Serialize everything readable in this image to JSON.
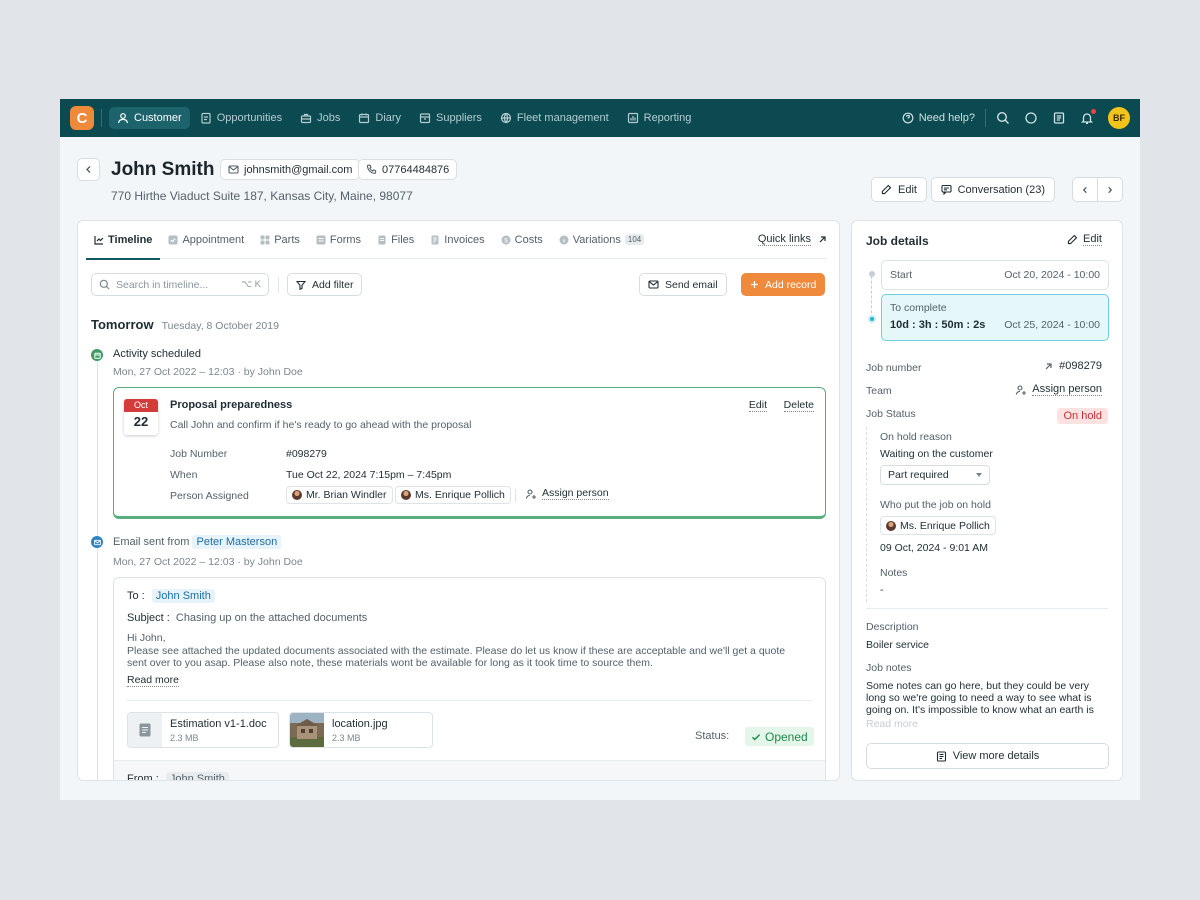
{
  "topbar": {
    "logo": "C",
    "nav": [
      {
        "label": "Customer",
        "icon": "user-icon",
        "active": true
      },
      {
        "label": "Opportunities",
        "icon": "clipboard-icon"
      },
      {
        "label": "Jobs",
        "icon": "briefcase-icon"
      },
      {
        "label": "Diary",
        "icon": "calendar-icon"
      },
      {
        "label": "Suppliers",
        "icon": "box-icon"
      },
      {
        "label": "Fleet management",
        "icon": "globe-icon"
      },
      {
        "label": "Reporting",
        "icon": "chart-icon"
      }
    ],
    "help": "Need help?",
    "avatar": "BF"
  },
  "header": {
    "name": "John Smith",
    "email": "johnsmith@gmail.com",
    "phone": "07764484876",
    "address": "770 Hirthe Viaduct Suite 187, Kansas City, Maine, 98077",
    "edit_label": "Edit",
    "conversation_label": "Conversation (23)"
  },
  "tabs": {
    "items": [
      {
        "label": "Timeline",
        "active": true
      },
      {
        "label": "Appointment"
      },
      {
        "label": "Parts"
      },
      {
        "label": "Forms"
      },
      {
        "label": "Files"
      },
      {
        "label": "Invoices"
      },
      {
        "label": "Costs"
      },
      {
        "label": "Variations",
        "badge": "104"
      }
    ],
    "quick_links": "Quick links"
  },
  "toolbar": {
    "search_placeholder": "Search in timeline...",
    "search_shortcut": "⌥ K",
    "add_filter": "Add filter",
    "send_email": "Send email",
    "add_record": "Add record"
  },
  "timeline": {
    "day": "Tomorrow",
    "date": "Tuesday, 8 October 2019",
    "event1": {
      "title": "Activity scheduled",
      "meta": "Mon, 27 Oct 2022 – 12:03",
      "by": "by John Doe",
      "card": {
        "cal_month": "Oct",
        "cal_day": "22",
        "title": "Proposal preparedness",
        "subtitle": "Call John and confirm if he's ready to go ahead with the proposal",
        "edit": "Edit",
        "delete": "Delete",
        "job_number_label": "Job Number",
        "job_number": "#098279",
        "when_label": "When",
        "when": "Tue Oct 22, 2024 7:15pm – 7:45pm",
        "person_label": "Person Assigned",
        "person1": "Mr. Brian Windler",
        "person2": "Ms. Enrique Pollich",
        "assign": "Assign person"
      }
    },
    "event2": {
      "title_prefix": "Email sent from",
      "sender": "Peter Masterson",
      "meta": "Mon, 27 Oct 2022 – 12:03",
      "by": "by John Doe",
      "to_label": "To :",
      "to": "John Smith",
      "subject_label": "Subject :",
      "subject": "Chasing up on the attached documents",
      "body": "Hi John,\nPlease see attached the updated documents associated with the estimate.  Please do let us know  if these are acceptable and we'll get a quote sent over to you asap. Please also note, these materials wont be available for long as it took time to source them.",
      "read_more": "Read more",
      "attachments": [
        {
          "name": "Estimation v1-1.doc",
          "size": "2.3 MB"
        },
        {
          "name": "location.jpg",
          "size": "2.3 MB"
        }
      ],
      "status_label": "Status:",
      "status": "Opened",
      "from_label": "From :",
      "from": "John Smith"
    }
  },
  "job": {
    "title": "Job details",
    "edit": "Edit",
    "start_label": "Start",
    "start": "Oct 20, 2024 - 10:00",
    "complete_label": "To complete",
    "countdown": "10d : 3h : 50m : 2s",
    "complete": "Oct 25, 2024 - 10:00",
    "job_number_label": "Job number",
    "job_number": "#098279",
    "team_label": "Team",
    "team": "Assign person",
    "status_label": "Job Status",
    "status": "On hold",
    "reason_label": "On hold reason",
    "reason": "Waiting on the customer",
    "reason_select": "Part required",
    "who_label": "Who put the job on hold",
    "who": "Ms. Enrique Pollich",
    "who_date": "09 Oct, 2024 - 9:01 AM",
    "notes_label": "Notes",
    "notes": "-",
    "desc_label": "Description",
    "desc": "Boiler service",
    "jobnotes_label": "Job notes",
    "jobnotes": "Some notes can go here, but they could be very long so we're going to need a way to see what is going on. It's impossible to know what an earth is happening a...",
    "read_more": "Read more",
    "view_more": "View more details"
  }
}
